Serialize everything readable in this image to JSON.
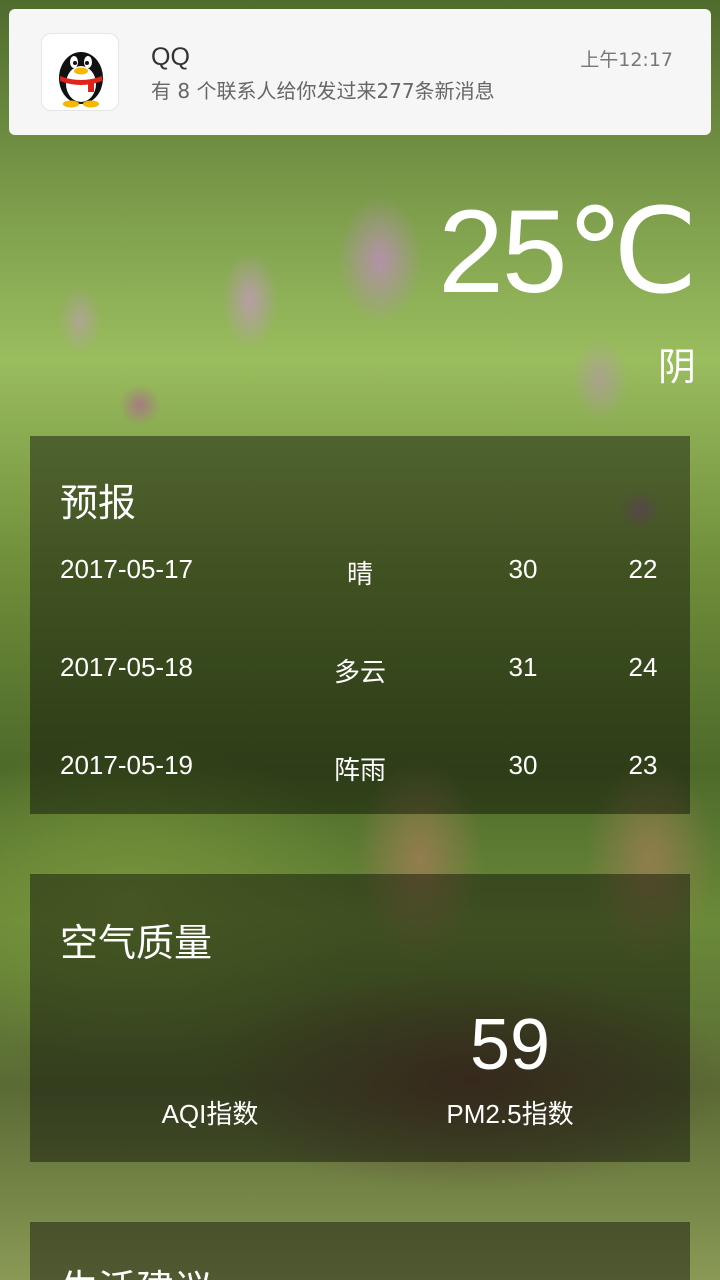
{
  "notification": {
    "app_name": "QQ",
    "message": "有 8 个联系人给你发过来277条新消息",
    "time": "上午12:17",
    "icon": "qq-penguin-icon"
  },
  "weather": {
    "temperature": "25℃",
    "condition": "阴"
  },
  "forecast": {
    "title": "预报",
    "days": [
      {
        "date": "2017-05-17",
        "condition": "晴",
        "max": "30",
        "min": "22"
      },
      {
        "date": "2017-05-18",
        "condition": "多云",
        "max": "31",
        "min": "24"
      },
      {
        "date": "2017-05-19",
        "condition": "阵雨",
        "max": "30",
        "min": "23"
      }
    ]
  },
  "air_quality": {
    "title": "空气质量",
    "aqi_label": "AQI指数",
    "aqi_value": "",
    "pm25_label": "PM2.5指数",
    "pm25_value": "59"
  },
  "suggestion": {
    "title": "生活建议"
  }
}
